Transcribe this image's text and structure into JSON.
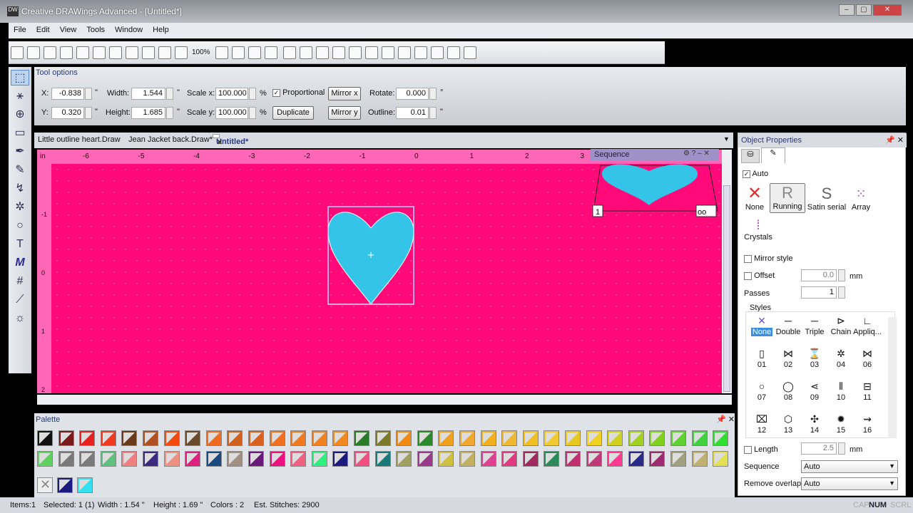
{
  "window": {
    "title": "Creative DRAWings Advanced - [Untitled*]",
    "min": "‒",
    "max": "▢",
    "close": "✕"
  },
  "menu": [
    "File",
    "Edit",
    "View",
    "Tools",
    "Window",
    "Help"
  ],
  "toolbar": {
    "zoom": "100%"
  },
  "tool_options": {
    "title": "Tool options",
    "x_label": "X:",
    "x": "-0.838",
    "y_label": "Y:",
    "y": "0.320",
    "width_label": "Width:",
    "width": "1.544",
    "height_label": "Height:",
    "height": "1.685",
    "scalex_label": "Scale x:",
    "scalex": "100.000",
    "scaley_label": "Scale y:",
    "scaley": "100.000",
    "unit_in": "\"",
    "unit_pct": "%",
    "unit_deg": "°",
    "proportional": "Proportional",
    "proportional_checked": true,
    "mirrorx": "Mirror x",
    "mirrory": "Mirror y",
    "duplicate": "Duplicate",
    "rotate_label": "Rotate:",
    "rotate": "0.000",
    "outline_label": "Outline:",
    "outline": "0.01"
  },
  "doc_tabs": [
    {
      "label": "Little outline heart.Draw"
    },
    {
      "label": "Jean Jacket back.Draw*"
    },
    {
      "label": "Untitled*",
      "active": true
    }
  ],
  "ruler": {
    "unit": "in",
    "ticks": [
      "-6",
      "-5",
      "-4",
      "-3",
      "-2",
      "-1",
      "0",
      "1",
      "2",
      "3"
    ],
    "vticks": [
      "-1",
      "0",
      "1",
      "2"
    ]
  },
  "sequence": {
    "title": "Sequence",
    "item_number": "1",
    "fill_color": "#33c4e8"
  },
  "canvas": {
    "background": "#ff0a78",
    "heart_color": "#33c4e8"
  },
  "palette": {
    "title": "Palette",
    "row1": [
      "#111111",
      "#7a1a1a",
      "#e82020",
      "#f03a20",
      "#6a3a1a",
      "#b05020",
      "#f04a10",
      "#6a4a2a",
      "#f06a20",
      "#d06020",
      "#d86020",
      "#f07020",
      "#f07a20",
      "#f08020",
      "#f08a20",
      "#2a7a2a",
      "#7a7a2a",
      "#f08a10",
      "#2a8a2a",
      "#f0a020",
      "#f0a830",
      "#f0b020",
      "#f0b830",
      "#f0c020",
      "#f0c830",
      "#e8c820",
      "#f0d020",
      "#d0d020",
      "#a0d020",
      "#80d020",
      "#60d030",
      "#40d040",
      "#30e030"
    ],
    "row2": [
      "#60d060",
      "#7a7a7a",
      "#7a7a7a",
      "#60c080",
      "#f08080",
      "#3a2a80",
      "#f09080",
      "#e02080",
      "#1a4a80",
      "#a09080",
      "#6a1a7a",
      "#f01080",
      "#f06080",
      "#30f080",
      "#1a1a80",
      "#f05080",
      "#1a7a7a",
      "#a0a060",
      "#9a3a8a",
      "#d0c040",
      "#c0b060",
      "#e04090",
      "#e03a80",
      "#a02a60",
      "#2a8a5a",
      "#c03070",
      "#c03a7a",
      "#ff3a90",
      "#2a2a8a",
      "#a02a70",
      "#a0a080",
      "#c0b070",
      "#e0e050"
    ],
    "current": [
      {
        "name": "none"
      },
      {
        "name": "outline",
        "color": "#1a1a80"
      },
      {
        "name": "fill",
        "color": "#33e0f0"
      }
    ]
  },
  "status": {
    "items": "Items:1",
    "selected": "Selected: 1 (1)",
    "width": "Width : 1.54 \"",
    "height": "Height : 1.69 \"",
    "colors": "Colors : 2",
    "stitches": "Est. Stitches: 2900",
    "cap": "CAP",
    "num": "NUM",
    "scrl": "SCRL"
  },
  "props": {
    "title": "Object Properties",
    "auto": "Auto",
    "types": [
      "None",
      "Running",
      "Satin serial",
      "Array",
      "Crystals"
    ],
    "active_type": "Running",
    "mirror_style": "Mirror style",
    "offset": "Offset",
    "offset_value": "0.0",
    "mm": "mm",
    "passes": "Passes",
    "passes_value": "1",
    "styles_title": "Styles",
    "styles": [
      [
        "None",
        "Double",
        "Triple",
        "Chain",
        "Appliq..."
      ],
      [
        "01",
        "02",
        "03",
        "04",
        "06"
      ],
      [
        "07",
        "08",
        "09",
        "10",
        "11"
      ],
      [
        "12",
        "13",
        "14",
        "15",
        "16"
      ]
    ],
    "style_icons": [
      [
        "✕",
        "─",
        "─",
        "⊳",
        "∟"
      ],
      [
        "▯",
        "⋈",
        "⌛",
        "✲",
        "⋈"
      ],
      [
        "○",
        "◯",
        "⋖",
        "⫴",
        "⊟"
      ],
      [
        "⌧",
        "⬡",
        "✣",
        "✹",
        "⇝"
      ]
    ],
    "length": "Length",
    "length_value": "2.5",
    "sequence_label": "Sequence",
    "sequence_value": "Auto",
    "overlaps_label": "Remove overlaps",
    "overlaps_value": "Auto"
  }
}
